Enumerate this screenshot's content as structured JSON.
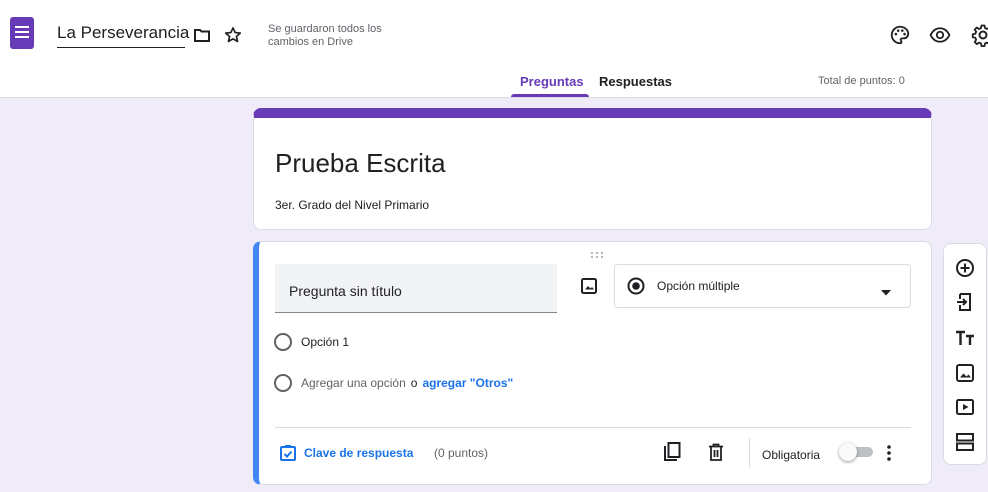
{
  "app": {
    "title": "La Perseverancia",
    "save_status": "Se guardaron todos los cambios en Drive",
    "logo_icon": "google-forms-icon"
  },
  "tabs": [
    {
      "label": "Preguntas",
      "active": true
    },
    {
      "label": "Respuestas",
      "active": false
    }
  ],
  "total_points": "Total de puntos: 0",
  "form": {
    "title": "Prueba Escrita",
    "description": "3er. Grado del Nivel Primario"
  },
  "question": {
    "title": "Pregunta sin título",
    "type": "Opción múltiple",
    "options": [
      "Opción 1"
    ],
    "add_option": "Agregar una opción",
    "or_word": "o",
    "add_other": "agregar \"Otros\"",
    "answer_key": "Clave de respuesta",
    "points": "(0 puntos)",
    "required": "Obligatoria",
    "required_on": false
  },
  "side_toolbar": [
    "add-question-icon",
    "import-questions-icon",
    "add-title-icon",
    "add-image-icon",
    "add-video-icon",
    "add-section-icon"
  ],
  "colors": {
    "accent": "#673ab7",
    "background": "#f0ebf8",
    "question_border": "#4285f4",
    "link": "#1a73e8"
  }
}
